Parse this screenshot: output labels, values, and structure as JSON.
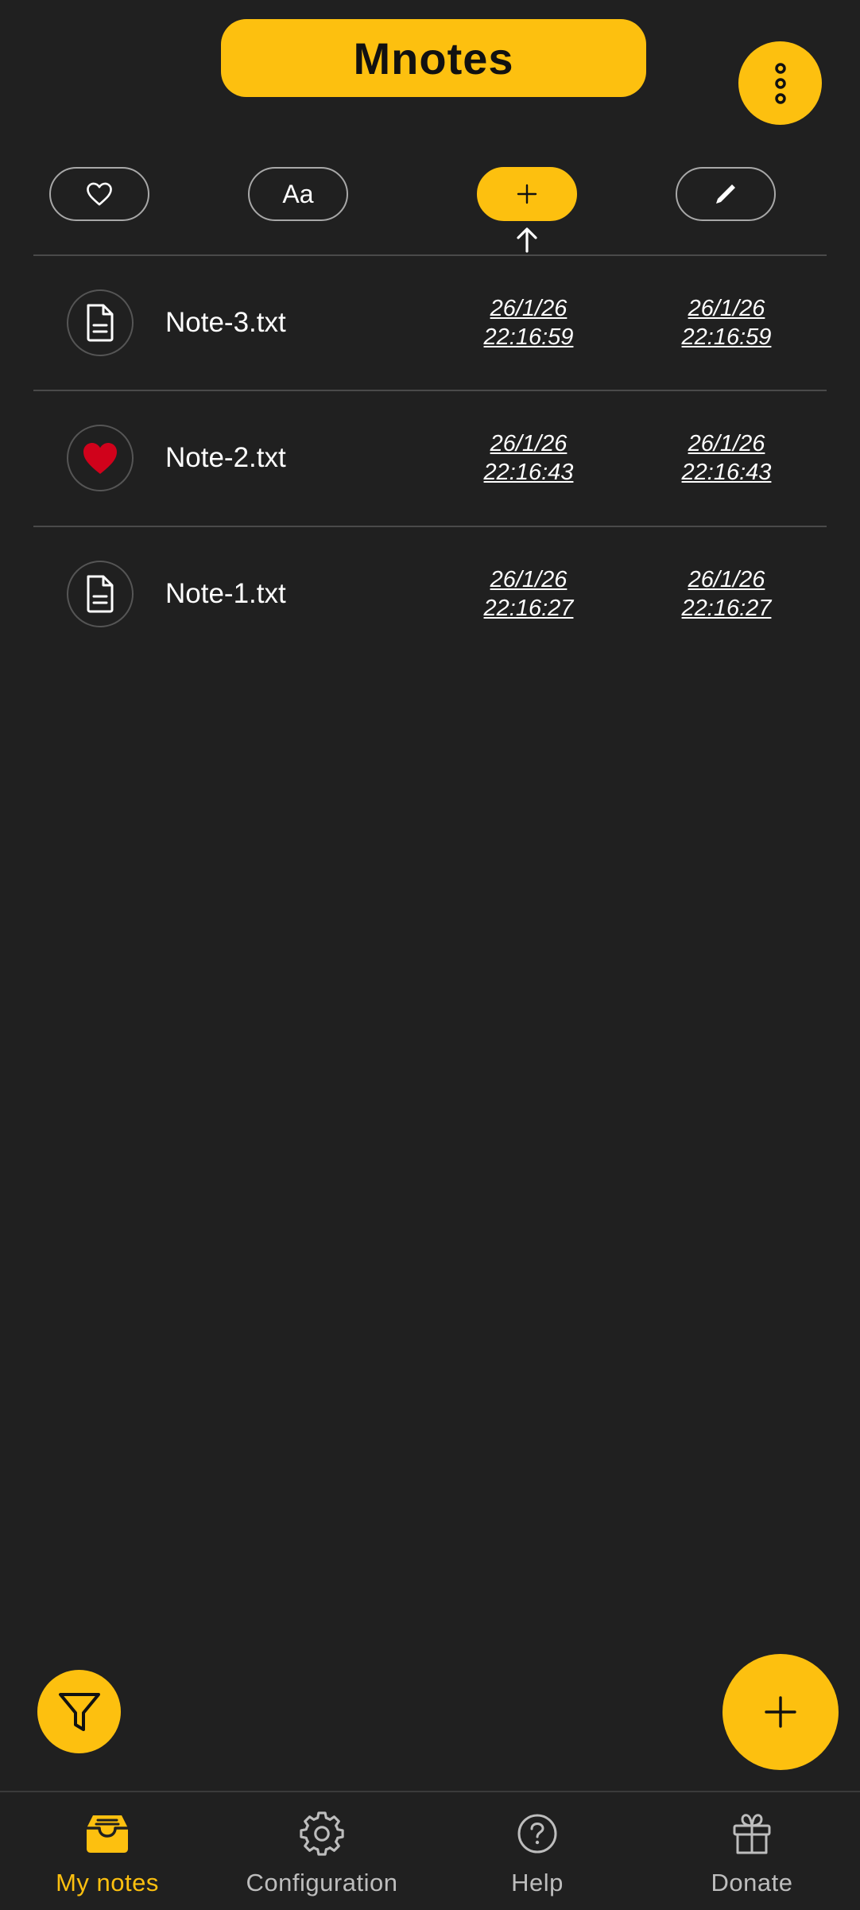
{
  "app": {
    "title": "Mnotes"
  },
  "header": {
    "menu_icon": "more-vertical-icon"
  },
  "sort_bar": {
    "buttons": [
      {
        "icon": "heart-outline-icon",
        "label": ""
      },
      {
        "icon": "",
        "label": "Aa"
      },
      {
        "icon": "plus-icon",
        "label": "",
        "active": true
      },
      {
        "icon": "pencil-icon",
        "label": ""
      }
    ],
    "sort_direction_icon": "arrow-up-icon"
  },
  "notes": [
    {
      "name": "Note-3.txt",
      "icon": "document-icon",
      "created_date": "26/1/26",
      "created_time": "22:16:59",
      "modified_date": "26/1/26",
      "modified_time": "22:16:59"
    },
    {
      "name": "Note-2.txt",
      "icon": "heart-filled-icon",
      "created_date": "26/1/26",
      "created_time": "22:16:43",
      "modified_date": "26/1/26",
      "modified_time": "22:16:43"
    },
    {
      "name": "Note-1.txt",
      "icon": "document-icon",
      "created_date": "26/1/26",
      "created_time": "22:16:27",
      "modified_date": "26/1/26",
      "modified_time": "22:16:27"
    }
  ],
  "fabs": {
    "filter_icon": "filter-icon",
    "add_icon": "plus-icon"
  },
  "bottom_nav": {
    "items": [
      {
        "label": "My notes",
        "icon": "inbox-icon",
        "active": true
      },
      {
        "label": "Configuration",
        "icon": "gear-icon"
      },
      {
        "label": "Help",
        "icon": "help-circle-icon"
      },
      {
        "label": "Donate",
        "icon": "gift-icon"
      }
    ]
  },
  "colors": {
    "accent": "#FDC00F",
    "background": "#202020",
    "favorite": "#D0021B"
  }
}
